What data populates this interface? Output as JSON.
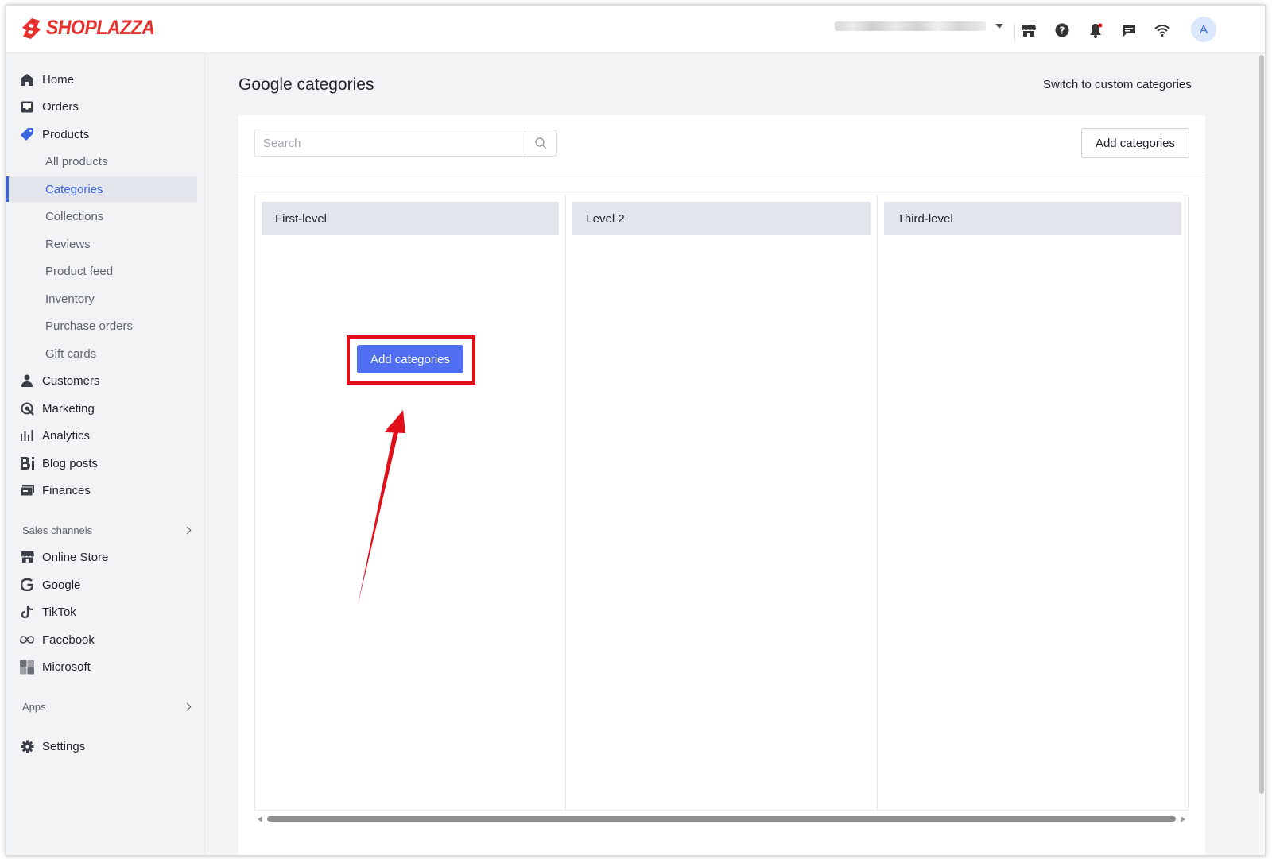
{
  "brand": {
    "name": "SHOPLAZZA",
    "color": "#e7312e"
  },
  "header": {
    "icons": [
      "store-icon",
      "help-icon",
      "bell-icon",
      "chat-icon",
      "wifi-icon"
    ],
    "avatar_initial": "A"
  },
  "sidebar": {
    "main_items": [
      {
        "label": "Home",
        "icon": "home-icon"
      },
      {
        "label": "Orders",
        "icon": "inbox-icon"
      },
      {
        "label": "Products",
        "icon": "tag-icon"
      }
    ],
    "product_sub_items": [
      {
        "label": "All products"
      },
      {
        "label": "Categories",
        "active": true
      },
      {
        "label": "Collections"
      },
      {
        "label": "Reviews"
      },
      {
        "label": "Product feed"
      },
      {
        "label": "Inventory"
      },
      {
        "label": "Purchase orders"
      },
      {
        "label": "Gift cards"
      }
    ],
    "more_items": [
      {
        "label": "Customers",
        "icon": "person-icon"
      },
      {
        "label": "Marketing",
        "icon": "marketing-icon"
      },
      {
        "label": "Analytics",
        "icon": "analytics-icon"
      },
      {
        "label": "Blog posts",
        "icon": "blog-icon"
      },
      {
        "label": "Finances",
        "icon": "finances-icon"
      }
    ],
    "sales_channels_label": "Sales channels",
    "channels": [
      {
        "label": "Online Store",
        "icon": "store-icon"
      },
      {
        "label": "Google",
        "icon": "google-icon"
      },
      {
        "label": "TikTok",
        "icon": "tiktok-icon"
      },
      {
        "label": "Facebook",
        "icon": "meta-icon"
      },
      {
        "label": "Microsoft",
        "icon": "microsoft-icon"
      }
    ],
    "apps_label": "Apps",
    "settings_label": "Settings"
  },
  "main": {
    "title": "Google categories",
    "switch_link": "Switch to custom categories",
    "search_placeholder": "Search",
    "add_button": "Add categories",
    "columns": [
      {
        "title": "First-level"
      },
      {
        "title": "Level 2"
      },
      {
        "title": "Third-level"
      }
    ],
    "empty_add_button": "Add categories"
  },
  "colors": {
    "accent": "#3b64e3",
    "primary_button": "#4f6ef2",
    "annotation": "#e0101a"
  }
}
